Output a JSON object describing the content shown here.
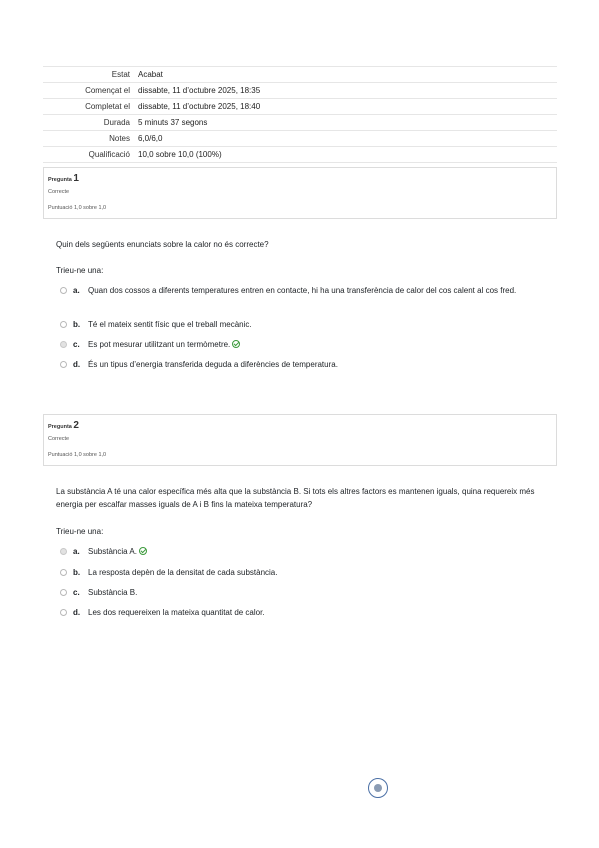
{
  "summary": [
    {
      "label": "Estat",
      "value": "Acabat"
    },
    {
      "label": "Començat el",
      "value": "dissabte, 11 d’octubre 2025, 18:35"
    },
    {
      "label": "Completat el",
      "value": "dissabte, 11 d’octubre 2025, 18:40"
    },
    {
      "label": "Durada",
      "value": "5 minuts 37 segons"
    },
    {
      "label": "Notes",
      "value": "6,0/6,0"
    },
    {
      "label": "Qualificació",
      "value": "10,0 sobre 10,0 (100%)"
    }
  ],
  "questions": [
    {
      "label": "Pregunta",
      "number": "1",
      "state": "Correcte",
      "grade": "Puntuació 1,0 sobre 1,0",
      "text": "Quin dels següents enunciats sobre la calor no és correcte?",
      "prompt": "Trieu-ne una:",
      "answers": [
        {
          "letter": "a.",
          "text": "Quan dos cossos a diferents temperatures entren en contacte, hi ha una transferència de calor del cos calent al cos fred."
        },
        {
          "letter": "b.",
          "text": "Té el mateix sentit físic que el treball mecànic."
        },
        {
          "letter": "c.",
          "text": "Es pot mesurar utilitzant un termòmetre.",
          "selected": true,
          "correct": true
        },
        {
          "letter": "d.",
          "text": "És un tipus d’energia transferida deguda a diferències de temperatura."
        }
      ]
    },
    {
      "label": "Pregunta",
      "number": "2",
      "state": "Correcte",
      "grade": "Puntuació 1,0 sobre 1,0",
      "text": "La substància A té una calor específica més alta que la substància B. Si tots els altres factors es mantenen iguals, quina requereix més energia per escalfar masses iguals de A i B fins la mateixa temperatura?",
      "prompt": "Trieu-ne una:",
      "answers": [
        {
          "letter": "a.",
          "text": "Substància A.",
          "selected": true,
          "correct": true
        },
        {
          "letter": "b.",
          "text": "La resposta depèn de la densitat de cada substància."
        },
        {
          "letter": "c.",
          "text": "Substància B."
        },
        {
          "letter": "d.",
          "text": "Les dos requereixen la mateixa quantitat de calor."
        }
      ]
    }
  ]
}
